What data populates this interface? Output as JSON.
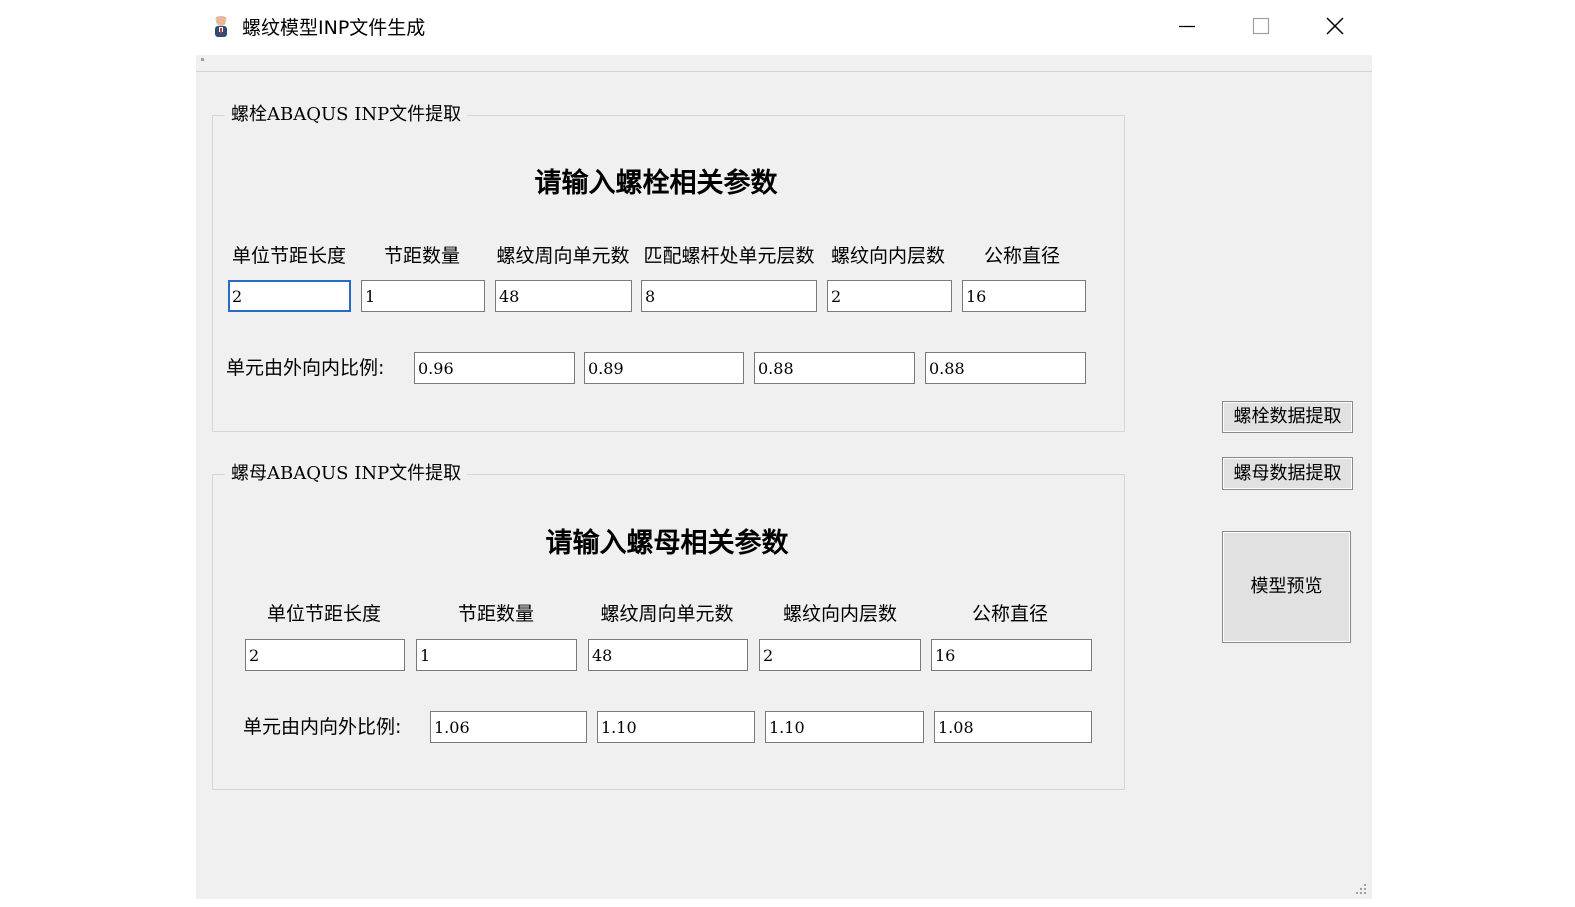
{
  "window": {
    "title": "螺纹模型INP文件生成",
    "controls": {
      "minimize": "minimize-icon",
      "maximize": "maximize-icon",
      "close": "close-icon"
    }
  },
  "bolt_group": {
    "legend": "螺栓ABAQUS INP文件提取",
    "heading": "请输入螺栓相关参数",
    "columns": [
      "单位节距长度",
      "节距数量",
      "螺纹周向单元数",
      "匹配螺杆处单元层数",
      "螺纹向内层数",
      "公称直径"
    ],
    "values": [
      "2",
      "1",
      "48",
      "8",
      "2",
      "16"
    ],
    "ratio_label": "单元由外向内比例:",
    "ratios": [
      "0.96",
      "0.89",
      "0.88",
      "0.88"
    ]
  },
  "nut_group": {
    "legend": "螺母ABAQUS INP文件提取",
    "heading": "请输入螺母相关参数",
    "columns": [
      "单位节距长度",
      "节距数量",
      "螺纹周向单元数",
      "螺纹向内层数",
      "公称直径"
    ],
    "values": [
      "2",
      "1",
      "48",
      "2",
      "16"
    ],
    "ratio_label": "单元由内向外比例:",
    "ratios": [
      "1.06",
      "1.10",
      "1.10",
      "1.08"
    ]
  },
  "buttons": {
    "bolt_extract": "螺栓数据提取",
    "nut_extract": "螺母数据提取",
    "preview": "模型预览"
  }
}
